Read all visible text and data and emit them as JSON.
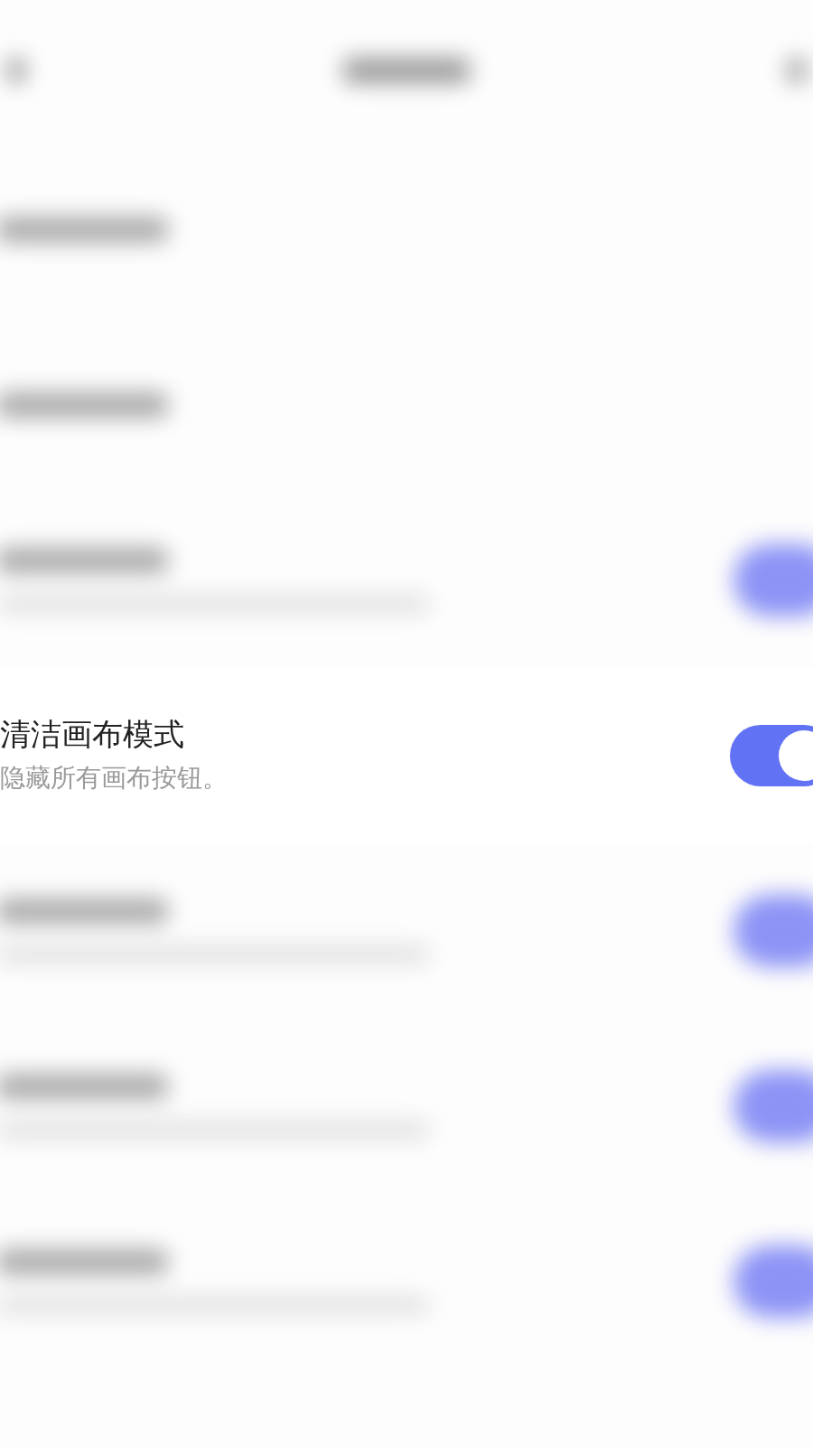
{
  "rows": [
    {
      "kind": "blurred_single"
    },
    {
      "kind": "blurred_single"
    },
    {
      "kind": "blurred_double",
      "on": true
    },
    {
      "kind": "setting",
      "title": "清洁画布模式",
      "subtitle": "隐藏所有画布按钮。",
      "on": true
    },
    {
      "kind": "blurred_double",
      "on": true
    },
    {
      "kind": "blurred_double",
      "on": true
    },
    {
      "kind": "blurred_double",
      "on": true
    }
  ]
}
